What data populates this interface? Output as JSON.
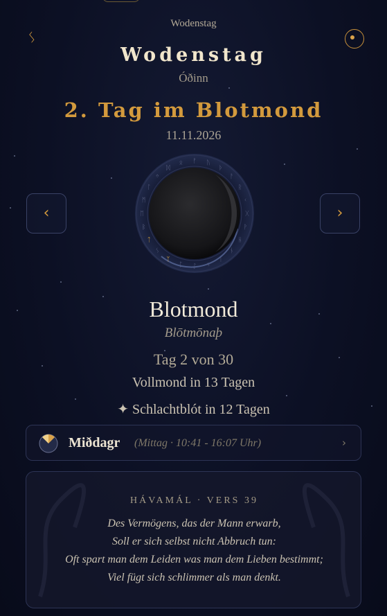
{
  "header": {
    "weekday_small": "Wodenstag",
    "weekday_title": "Wodenstag",
    "god_name": "Óðinn",
    "day_title": "2. Tag im Blotmond",
    "date": "11.11.2026",
    "rune_link_glyph": "ᛊ",
    "theme_icon": "moon-phase-icon"
  },
  "nav": {
    "prev_label": "‹",
    "next_label": "›"
  },
  "moon": {
    "illumination_label": "",
    "ring_runes": [
      "ᚠ",
      "ᚢ",
      "ᚦ",
      "ᚨ",
      "ᚱ",
      "ᚲ",
      "ᚷ",
      "ᚹ",
      "ᚺ",
      "ᚾ",
      "ᛁ",
      "ᛃ",
      "ᛇ",
      "ᛈ",
      "ᛉ",
      "ᛊ",
      "ᛏ",
      "ᛒ",
      "ᛖ",
      "ᛗ",
      "ᛚ",
      "ᛜ",
      "ᛞ",
      "ᛟ"
    ],
    "highlight_runes": [
      "ᛉ",
      "ᛏ"
    ]
  },
  "month": {
    "name": "Blotmond",
    "old_name": "Blōtmōnaþ",
    "day_count": "Tag 2 von 30",
    "full_moon": "Vollmond in 13 Tagen",
    "event": "✦ Schlachtblót in 12 Tagen"
  },
  "daytime": {
    "name": "Miðdagr",
    "detail": "(Mittag · 10:41 - 16:07 Uhr)",
    "chevron": "›",
    "icon": "sundial-icon"
  },
  "quote": {
    "heading": "HÁVAMÁL · VERS 39",
    "lines": [
      "Des Vermögens, das der Mann erwarb,",
      "Soll er sich selbst nicht Abbruch tun:",
      "Oft spart man dem Leiden was man dem Lieben bestimmt;",
      "Viel fügt sich schlimmer als man denkt."
    ]
  },
  "colors": {
    "accent_gold": "#d39a3d",
    "background": "#0c1024",
    "text_light": "#f1e6cc"
  }
}
